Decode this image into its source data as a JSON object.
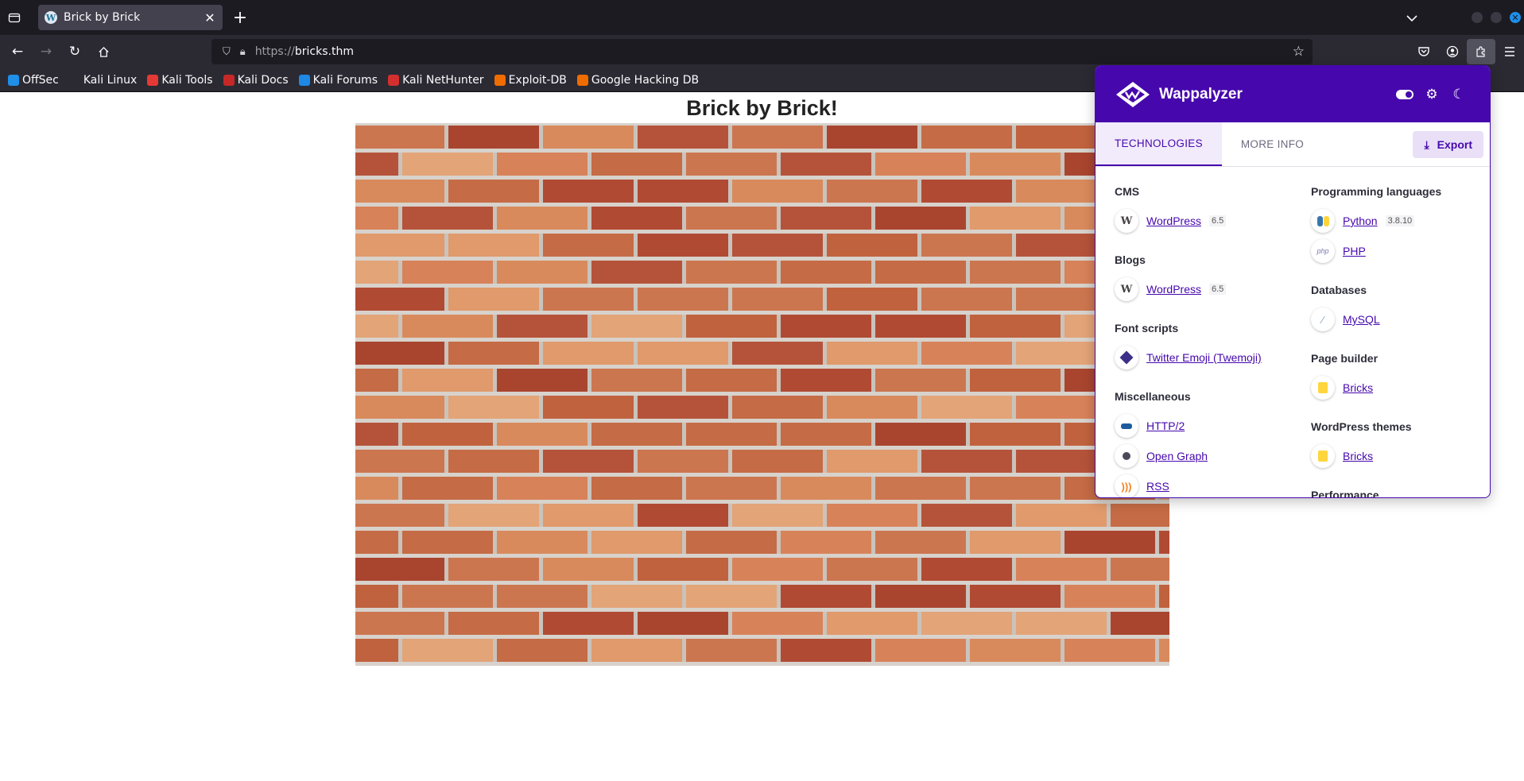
{
  "browser": {
    "tab_title": "Brick by Brick",
    "url_scheme": "https://",
    "url_host": "bricks.thm",
    "bookmarks": [
      {
        "label": "OffSec",
        "color": "#1f8fe8"
      },
      {
        "label": "Kali Linux",
        "color": "#2b2a33"
      },
      {
        "label": "Kali Tools",
        "color": "#e53935"
      },
      {
        "label": "Kali Docs",
        "color": "#c62828"
      },
      {
        "label": "Kali Forums",
        "color": "#1e88e5"
      },
      {
        "label": "Kali NetHunter",
        "color": "#d32f2f"
      },
      {
        "label": "Exploit-DB",
        "color": "#ef6c00"
      },
      {
        "label": "Google Hacking DB",
        "color": "#ef6c00"
      }
    ]
  },
  "page": {
    "title": "Brick by Brick!"
  },
  "wappalyzer": {
    "name": "Wappalyzer",
    "accent": "#4608ad",
    "tabs": [
      "TECHNOLOGIES",
      "MORE INFO"
    ],
    "export_label": "Export",
    "left_categories": [
      {
        "title": "CMS",
        "items": [
          {
            "name": "WordPress",
            "version": "6.5",
            "icon": "wordpress-icon"
          }
        ]
      },
      {
        "title": "Blogs",
        "items": [
          {
            "name": "WordPress",
            "version": "6.5",
            "icon": "wordpress-icon"
          }
        ]
      },
      {
        "title": "Font scripts",
        "items": [
          {
            "name": "Twitter Emoji (Twemoji)",
            "version": "",
            "icon": "twemoji-icon"
          }
        ]
      },
      {
        "title": "Miscellaneous",
        "items": [
          {
            "name": "HTTP/2",
            "version": "",
            "icon": "http2-icon"
          },
          {
            "name": "Open Graph",
            "version": "",
            "icon": "open-graph-icon"
          },
          {
            "name": "RSS",
            "version": "",
            "icon": "rss-icon"
          }
        ]
      }
    ],
    "right_categories": [
      {
        "title": "Programming languages",
        "items": [
          {
            "name": "Python",
            "version": "3.8.10",
            "icon": "python-icon"
          },
          {
            "name": "PHP",
            "version": "",
            "icon": "php-icon"
          }
        ]
      },
      {
        "title": "Databases",
        "items": [
          {
            "name": "MySQL",
            "version": "",
            "icon": "mysql-icon"
          }
        ]
      },
      {
        "title": "Page builder",
        "items": [
          {
            "name": "Bricks",
            "version": "",
            "icon": "bricks-icon"
          }
        ]
      },
      {
        "title": "WordPress themes",
        "items": [
          {
            "name": "Bricks",
            "version": "",
            "icon": "bricks-icon"
          }
        ]
      },
      {
        "title": "Performance",
        "items": []
      }
    ]
  }
}
